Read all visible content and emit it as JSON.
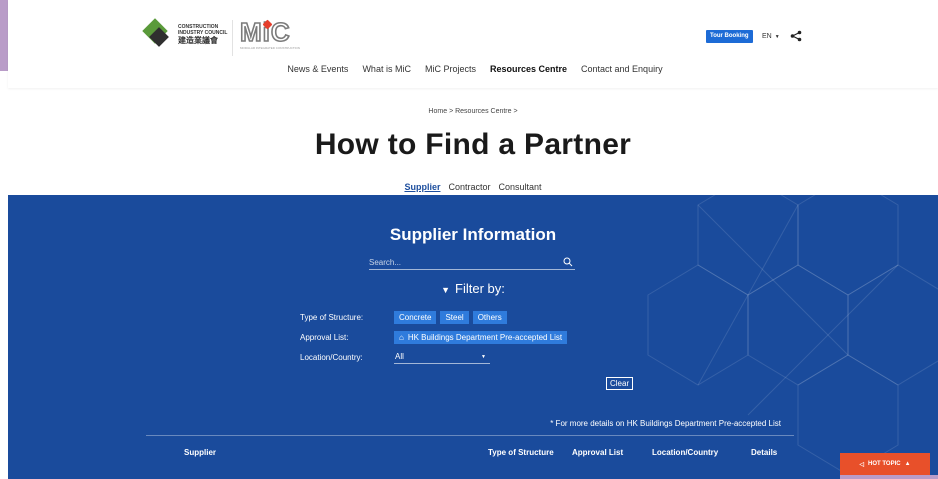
{
  "header": {
    "cic_logo": {
      "line1": "CONSTRUCTION",
      "line2": "INDUSTRY COUNCIL",
      "line3": "建造業議會"
    },
    "mic_logo": {
      "word": "MiC",
      "tagline": "MODULAR INTEGRATED CONSTRUCTION"
    },
    "tour_booking": "Tour Booking",
    "language": "EN"
  },
  "nav": {
    "items": [
      "News & Events",
      "What is MiC",
      "MiC Projects",
      "Resources Centre",
      "Contact and Enquiry"
    ]
  },
  "breadcrumb": {
    "home": "Home",
    "sep": ">",
    "section": "Resources Centre"
  },
  "page_title": "How to Find a Partner",
  "tabs": [
    "Supplier",
    "Contractor",
    "Consultant"
  ],
  "supplier_section": {
    "title": "Supplier Information",
    "search_placeholder": "Search...",
    "filter_title": "Filter by:",
    "type_label": "Type of Structure:",
    "type_options": [
      "Concrete",
      "Steel",
      "Others"
    ],
    "approval_label": "Approval List:",
    "approval_option": "HK Buildings Department Pre-accepted List",
    "location_label": "Location/Country:",
    "location_value": "All",
    "clear": "Clear",
    "note": "* For more details on HK Buildings Department Pre-accepted List",
    "columns": [
      "Supplier",
      "Type of Structure",
      "Approval List",
      "Location/Country",
      "Details"
    ]
  },
  "hot_topic": "HOT TOPIC",
  "colors": {
    "brand_blue": "#1a4b9c",
    "chip_blue": "#2f7bdc",
    "hot_topic": "#e8502a",
    "accent_purple": "#b99cc8"
  }
}
